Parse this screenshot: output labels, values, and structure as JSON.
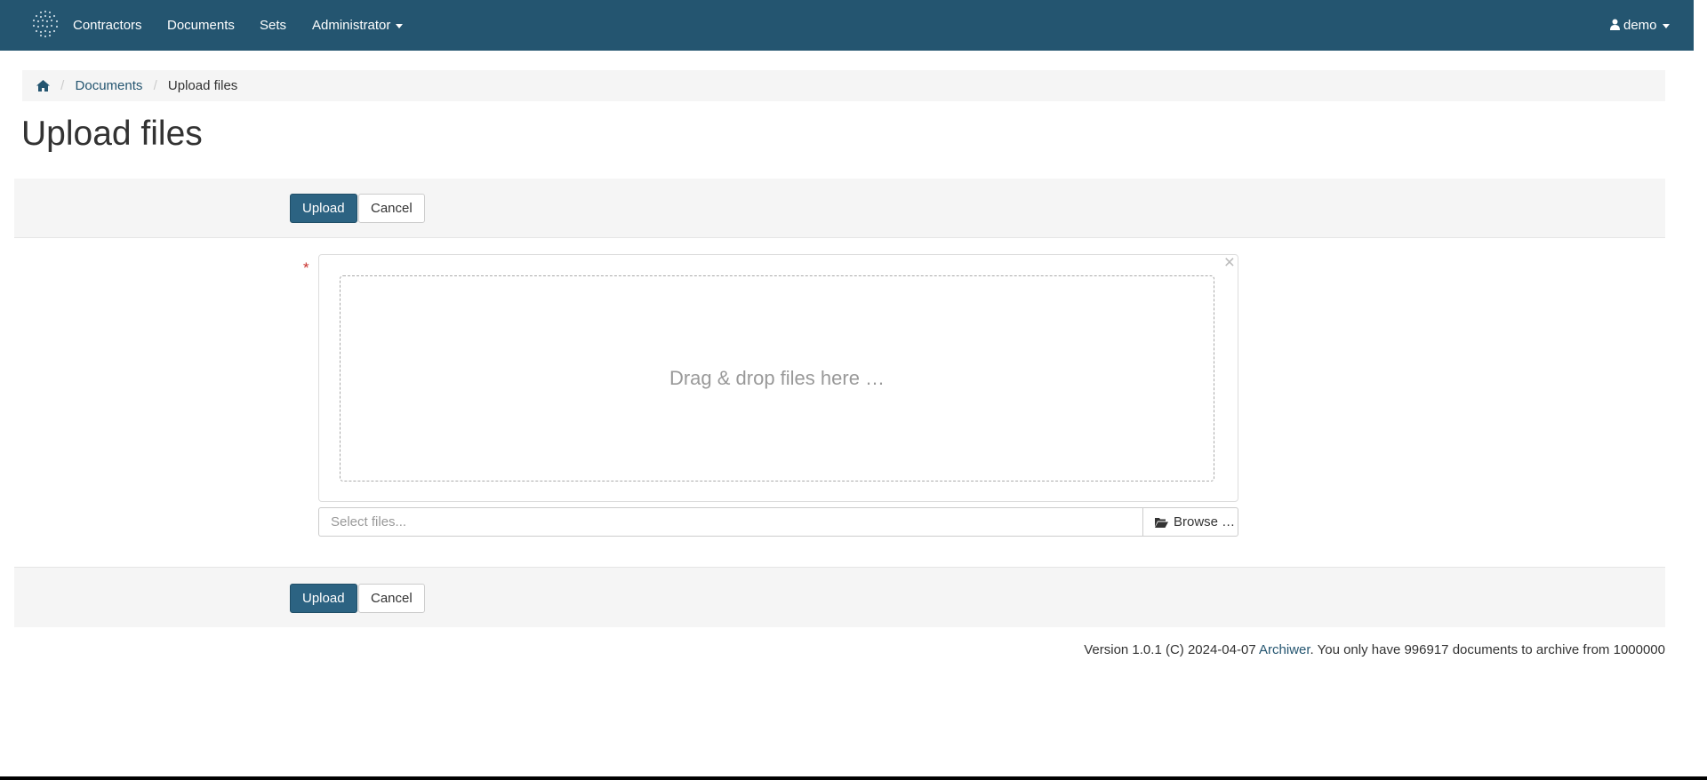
{
  "navbar": {
    "logo_icon": "globe-dots-logo",
    "items": [
      "Contractors",
      "Documents",
      "Sets"
    ],
    "admin_label": "Administrator",
    "user_label": "demo",
    "colors": {
      "background": "#245570",
      "text": "#ffffff"
    }
  },
  "breadcrumb": {
    "home_icon": "home-icon",
    "documents": "Documents",
    "current": "Upload files"
  },
  "page": {
    "title": "Upload files"
  },
  "actions": {
    "upload_label": "Upload",
    "cancel_label": "Cancel",
    "primary_color": "#2c6382"
  },
  "upload": {
    "required_marker": "*",
    "close_symbol": "×",
    "drop_text": "Drag & drop files here …",
    "input_placeholder": "Select files...",
    "browse_label": "Browse …"
  },
  "footer": {
    "prefix": "Version 1.0.1 (C) 2024-04-07 ",
    "link": "Archiwer",
    "suffix": ". You only have 996917 documents to archive from 1000000"
  }
}
